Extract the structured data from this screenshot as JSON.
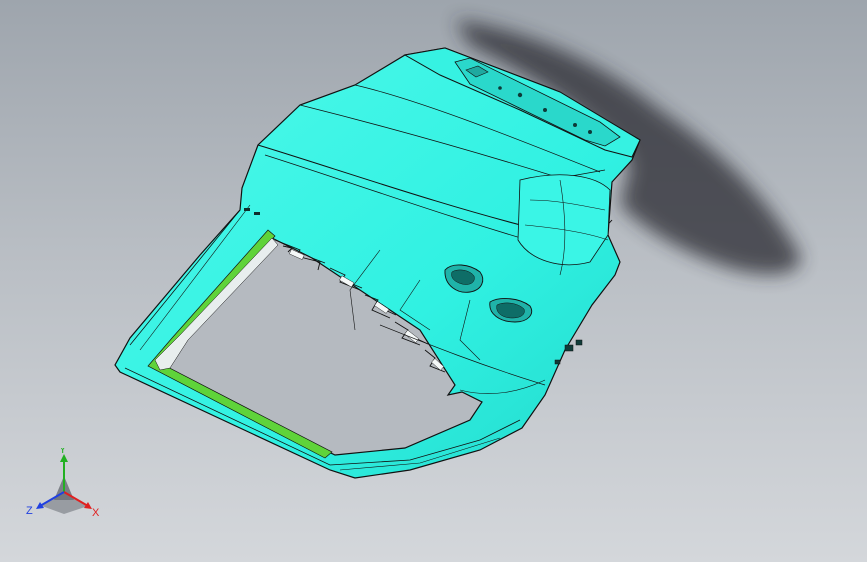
{
  "viewport": {
    "name": "3d-model-viewport",
    "background_top": "#9ea5ad",
    "background_bottom": "#d4d7db"
  },
  "model": {
    "name": "liftgate-panel",
    "surface_color": "#33f5e6",
    "edge_color": "#111111",
    "seal_color": "#5fd33a",
    "shadow_color": "#2a2c30"
  },
  "triad": {
    "x_label": "X",
    "y_label": "Y",
    "z_label": "Z",
    "x_color": "#e02020",
    "y_color": "#22b022",
    "z_color": "#2040e0"
  }
}
